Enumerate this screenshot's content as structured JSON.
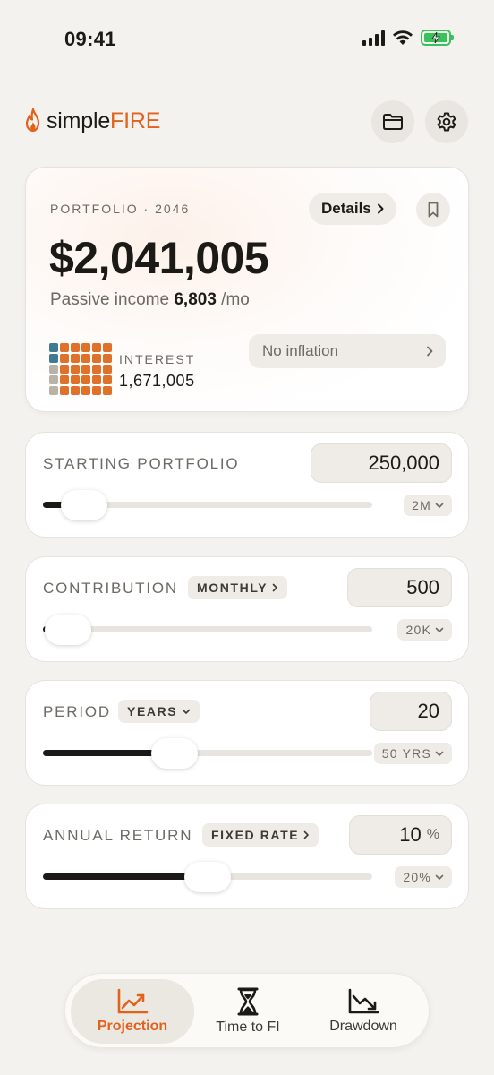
{
  "status_bar": {
    "time": "09:41"
  },
  "header": {
    "brand_part1": "simple",
    "brand_part2": "FIRE",
    "accent_color": "#e2621c"
  },
  "summary": {
    "label": "PORTFOLIO · 2046",
    "details_label": "Details",
    "total": "$2,041,005",
    "passive_prefix": "Passive income",
    "passive_value": "6,803",
    "passive_suffix": "/mo",
    "interest_label": "INTEREST",
    "interest_value": "1,671,005",
    "inflation_label": "No inflation"
  },
  "controls": [
    {
      "label": "STARTING PORTFOLIO",
      "value": "250,000",
      "max": "2M"
    },
    {
      "label": "CONTRIBUTION",
      "mode": "MONTHLY",
      "value": "500",
      "max": "20K"
    },
    {
      "label": "PERIOD",
      "mode": "YEARS",
      "value": "20",
      "max": "50 YRS"
    },
    {
      "label": "ANNUAL RETURN",
      "mode": "FIXED RATE",
      "value": "10",
      "unit": "%",
      "max": "20%"
    }
  ],
  "slider_levels": [
    0.125,
    0.025,
    0.4,
    0.5
  ],
  "tabs": [
    {
      "label": "Projection",
      "icon": "chart-up-icon",
      "active": true
    },
    {
      "label": "Time to FI",
      "icon": "hourglass-icon",
      "active": false
    },
    {
      "label": "Drawdown",
      "icon": "chart-down-icon",
      "active": false
    }
  ]
}
